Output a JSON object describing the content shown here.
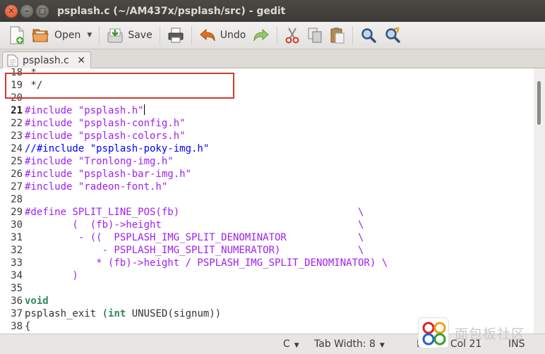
{
  "window": {
    "title": "psplash.c (~/AM437x/psplash/src) - gedit",
    "close_glyph": "✕",
    "min_glyph": "–",
    "max_glyph": "□"
  },
  "toolbar": {
    "open_label": "Open",
    "save_label": "Save",
    "undo_label": "Undo"
  },
  "tabs": [
    {
      "label": "psplash.c",
      "close_glyph": "✕"
    }
  ],
  "editor": {
    "current_line": 21,
    "lines": [
      {
        "num": "18",
        "tokens": [
          {
            "t": " *",
            "c": "code"
          }
        ]
      },
      {
        "num": "19",
        "tokens": [
          {
            "t": " */",
            "c": "code"
          }
        ]
      },
      {
        "num": "20",
        "tokens": []
      },
      {
        "num": "21",
        "tokens": [
          {
            "t": "#include ",
            "c": "pp"
          },
          {
            "t": "\"psplash.h\"",
            "c": "st"
          }
        ]
      },
      {
        "num": "22",
        "tokens": [
          {
            "t": "#include ",
            "c": "pp"
          },
          {
            "t": "\"psplash-config.h\"",
            "c": "st"
          }
        ]
      },
      {
        "num": "23",
        "tokens": [
          {
            "t": "#include ",
            "c": "pp"
          },
          {
            "t": "\"psplash-colors.h\"",
            "c": "st"
          }
        ]
      },
      {
        "num": "24",
        "tokens": [
          {
            "t": "//#include \"psplash-poky-img.h\"",
            "c": "cm"
          }
        ]
      },
      {
        "num": "25",
        "tokens": [
          {
            "t": "#include ",
            "c": "pp"
          },
          {
            "t": "\"Tronlong-img.h\"",
            "c": "st"
          }
        ]
      },
      {
        "num": "26",
        "tokens": [
          {
            "t": "#include ",
            "c": "pp"
          },
          {
            "t": "\"psplash-bar-img.h\"",
            "c": "st"
          }
        ]
      },
      {
        "num": "27",
        "tokens": [
          {
            "t": "#include ",
            "c": "pp"
          },
          {
            "t": "\"radeon-font.h\"",
            "c": "st"
          }
        ]
      },
      {
        "num": "28",
        "tokens": []
      },
      {
        "num": "29",
        "tokens": [
          {
            "t": "#define SPLIT_LINE_POS(fb)                              \\",
            "c": "pp"
          }
        ]
      },
      {
        "num": "30",
        "tokens": [
          {
            "t": "        (  (fb)->height                                 \\",
            "c": "pp"
          }
        ]
      },
      {
        "num": "31",
        "tokens": [
          {
            "t": "         - ((  PSPLASH_IMG_SPLIT_DENOMINATOR            \\",
            "c": "pp"
          }
        ]
      },
      {
        "num": "32",
        "tokens": [
          {
            "t": "             - PSPLASH_IMG_SPLIT_NUMERATOR)             \\",
            "c": "pp"
          }
        ]
      },
      {
        "num": "33",
        "tokens": [
          {
            "t": "            * (fb)->height / PSPLASH_IMG_SPLIT_DENOMINATOR) \\",
            "c": "pp"
          }
        ]
      },
      {
        "num": "34",
        "tokens": [
          {
            "t": "        )",
            "c": "pp"
          }
        ]
      },
      {
        "num": "35",
        "tokens": []
      },
      {
        "num": "36",
        "tokens": [
          {
            "t": "void",
            "c": "ty"
          }
        ]
      },
      {
        "num": "37",
        "tokens": [
          {
            "t": "psplash_exit (",
            "c": "code"
          },
          {
            "t": "int",
            "c": "ty"
          },
          {
            "t": " UNUSED(signum))",
            "c": "code"
          }
        ]
      },
      {
        "num": "38",
        "tokens": [
          {
            "t": "{",
            "c": "code"
          }
        ]
      }
    ]
  },
  "statusbar": {
    "language": "C",
    "tab_width": "Tab Width: 8",
    "position": "Ln 21, Col 21",
    "mode": "INS"
  },
  "watermark": {
    "text": "面包板社区"
  }
}
